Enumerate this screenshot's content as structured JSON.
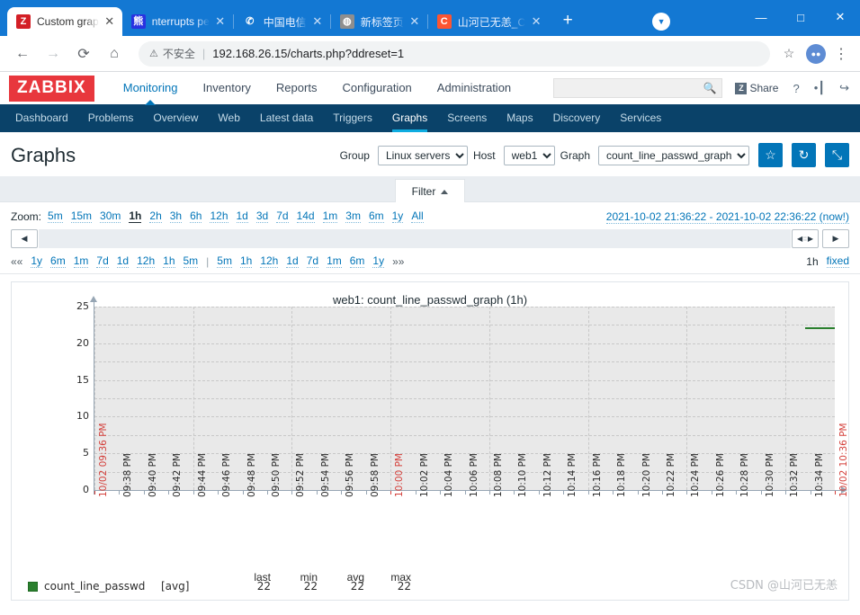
{
  "browser": {
    "tabs": [
      {
        "title": "Custom grap",
        "favicon": "zabbix-icon",
        "active": true,
        "close": "✕"
      },
      {
        "title": "nterrupts pe",
        "favicon": "baidu-icon",
        "active": false,
        "close": "✕"
      },
      {
        "title": "中国电信",
        "favicon": "telecom-icon",
        "active": false,
        "close": "✕"
      },
      {
        "title": "新标签页",
        "favicon": "sina-icon",
        "active": false,
        "close": "✕"
      },
      {
        "title": "山河已无恙_C",
        "favicon": "csdn-icon",
        "active": false,
        "close": "✕"
      }
    ],
    "new_tab_label": "+",
    "tab_search_label": "▼",
    "window_controls": {
      "minimize": "—",
      "maximize": "□",
      "close": "✕"
    },
    "toolbar": {
      "back": "←",
      "forward": "→",
      "reload": "⟳",
      "home": "⌂",
      "security_icon": "⚠",
      "security_text": "不安全",
      "divider": "|",
      "url": "192.168.26.15/charts.php?ddreset=1",
      "bookmark_star": "☆",
      "profile_initial": "●●",
      "menu": "⋮"
    }
  },
  "zabbix": {
    "logo": "ZABBIX",
    "main_nav": [
      {
        "label": "Monitoring",
        "active": true
      },
      {
        "label": "Inventory",
        "active": false
      },
      {
        "label": "Reports",
        "active": false
      },
      {
        "label": "Configuration",
        "active": false
      },
      {
        "label": "Administration",
        "active": false
      }
    ],
    "search_placeholder": "",
    "search_value": "",
    "search_icon": "search-icon",
    "share_label": "Share",
    "share_badge": "Z",
    "help_icon": "?",
    "user_icon": "•┃",
    "signout_icon": "↪",
    "sub_nav": [
      {
        "label": "Dashboard",
        "active": false
      },
      {
        "label": "Problems",
        "active": false
      },
      {
        "label": "Overview",
        "active": false
      },
      {
        "label": "Web",
        "active": false
      },
      {
        "label": "Latest data",
        "active": false
      },
      {
        "label": "Triggers",
        "active": false
      },
      {
        "label": "Graphs",
        "active": true
      },
      {
        "label": "Screens",
        "active": false
      },
      {
        "label": "Maps",
        "active": false
      },
      {
        "label": "Discovery",
        "active": false
      },
      {
        "label": "Services",
        "active": false
      }
    ]
  },
  "page": {
    "title": "Graphs",
    "controls": {
      "group_label": "Group",
      "group_value": "Linux servers",
      "host_label": "Host",
      "host_value": "web1",
      "graph_label": "Graph",
      "graph_value": "count_line_passwd_graph",
      "favorite_icon": "☆",
      "refresh_icon": "↻",
      "kiosk_icon": "⤡"
    },
    "filter_tab_label": "Filter"
  },
  "time_selector": {
    "zoom_label": "Zoom:",
    "zoom_options": [
      {
        "label": "5m",
        "selected": false
      },
      {
        "label": "15m",
        "selected": false
      },
      {
        "label": "30m",
        "selected": false
      },
      {
        "label": "1h",
        "selected": true
      },
      {
        "label": "2h",
        "selected": false
      },
      {
        "label": "3h",
        "selected": false
      },
      {
        "label": "6h",
        "selected": false
      },
      {
        "label": "12h",
        "selected": false
      },
      {
        "label": "1d",
        "selected": false
      },
      {
        "label": "3d",
        "selected": false
      },
      {
        "label": "7d",
        "selected": false
      },
      {
        "label": "14d",
        "selected": false
      },
      {
        "label": "1m",
        "selected": false
      },
      {
        "label": "3m",
        "selected": false
      },
      {
        "label": "6m",
        "selected": false
      },
      {
        "label": "1y",
        "selected": false
      },
      {
        "label": "All",
        "selected": false
      }
    ],
    "range_text": "2021-10-02 21:36:22 - 2021-10-02 22:36:22 (now!)",
    "slider": {
      "left_arrow": "◀",
      "handle_left": "◀",
      "handle_dots": "∶∶",
      "handle_right": "▶",
      "right_arrow": "▶"
    },
    "nav_left": [
      "««",
      "1y",
      "6m",
      "1m",
      "7d",
      "1d",
      "12h",
      "1h",
      "5m"
    ],
    "nav_separator": "|",
    "nav_right": [
      "5m",
      "1h",
      "12h",
      "1d",
      "7d",
      "1m",
      "6m",
      "1y",
      "»»"
    ],
    "current_period": "1h",
    "fixed_label": "fixed"
  },
  "chart_data": {
    "type": "line",
    "title": "web1: count_line_passwd_graph (1h)",
    "xlabel": "",
    "ylabel": "",
    "ylim": [
      0,
      25
    ],
    "yticks": [
      0,
      5,
      10,
      15,
      20,
      25
    ],
    "grid": true,
    "legend_position": "bottom-left",
    "series": [
      {
        "name": "count_line_passwd",
        "aggregate": "[avg]",
        "color": "#2a7f2e",
        "last": 22,
        "min": 22,
        "avg": 22,
        "max": 22,
        "x": [
          "10:34 PM",
          "10:36 PM"
        ],
        "values": [
          22,
          22
        ]
      }
    ],
    "xtick_labels": [
      {
        "label": "10/02 09:36 PM",
        "highlight": true
      },
      {
        "label": "09:38 PM",
        "highlight": false
      },
      {
        "label": "09:40 PM",
        "highlight": false
      },
      {
        "label": "09:42 PM",
        "highlight": false
      },
      {
        "label": "09:44 PM",
        "highlight": false
      },
      {
        "label": "09:46 PM",
        "highlight": false
      },
      {
        "label": "09:48 PM",
        "highlight": false
      },
      {
        "label": "09:50 PM",
        "highlight": false
      },
      {
        "label": "09:52 PM",
        "highlight": false
      },
      {
        "label": "09:54 PM",
        "highlight": false
      },
      {
        "label": "09:56 PM",
        "highlight": false
      },
      {
        "label": "09:58 PM",
        "highlight": false
      },
      {
        "label": "10:00 PM",
        "highlight": true
      },
      {
        "label": "10:02 PM",
        "highlight": false
      },
      {
        "label": "10:04 PM",
        "highlight": false
      },
      {
        "label": "10:06 PM",
        "highlight": false
      },
      {
        "label": "10:08 PM",
        "highlight": false
      },
      {
        "label": "10:10 PM",
        "highlight": false
      },
      {
        "label": "10:12 PM",
        "highlight": false
      },
      {
        "label": "10:14 PM",
        "highlight": false
      },
      {
        "label": "10:16 PM",
        "highlight": false
      },
      {
        "label": "10:18 PM",
        "highlight": false
      },
      {
        "label": "10:20 PM",
        "highlight": false
      },
      {
        "label": "10:22 PM",
        "highlight": false
      },
      {
        "label": "10:24 PM",
        "highlight": false
      },
      {
        "label": "10:26 PM",
        "highlight": false
      },
      {
        "label": "10:28 PM",
        "highlight": false
      },
      {
        "label": "10:30 PM",
        "highlight": false
      },
      {
        "label": "10:32 PM",
        "highlight": false
      },
      {
        "label": "10:34 PM",
        "highlight": false
      },
      {
        "label": "10/02 10:36 PM",
        "highlight": true
      }
    ],
    "legend_headers": [
      "last",
      "min",
      "avg",
      "max"
    ]
  },
  "watermark": "CSDN @山河已无恙"
}
